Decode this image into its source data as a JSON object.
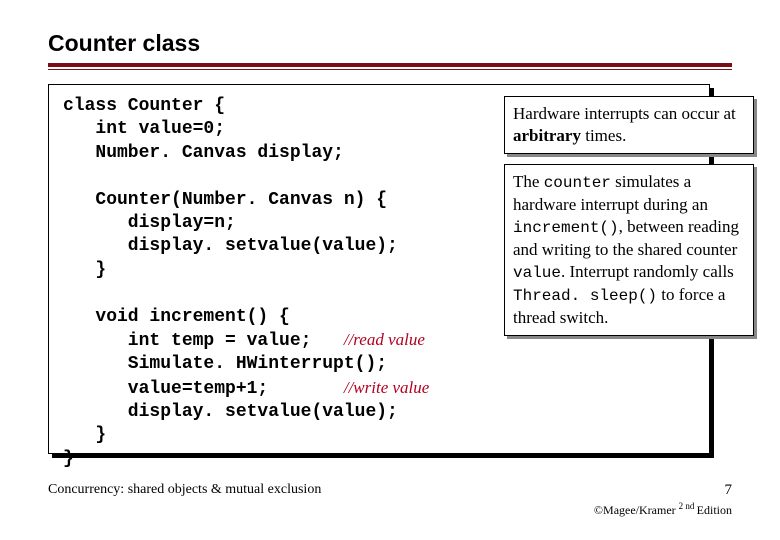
{
  "title": "Counter class",
  "code": {
    "l1": "class Counter {",
    "l2": "   int value=0;",
    "l3": "   Number. Canvas display;",
    "l4": "",
    "l5": "   Counter(Number. Canvas n) {",
    "l6": "      display=n;",
    "l7": "      display. setvalue(value);",
    "l8": "   }",
    "l9": "",
    "l10": "   void increment() {",
    "l11a": "      int temp = value;   ",
    "l11c": "//read value",
    "l12": "      Simulate. HWinterrupt();",
    "l13a": "      value=temp+1;       ",
    "l13c": "//write value",
    "l14": "      display. setvalue(value);",
    "l15": "   }",
    "l16": "}"
  },
  "callout1": {
    "t1": "Hardware interrupts can occur at ",
    "bold1": "arbitrary",
    "t2": " times."
  },
  "callout2": {
    "t1": "The ",
    "m1": "counter",
    "t2": " simulates a hardware interrupt during an ",
    "m2": "increment()",
    "t3": ", between reading and writing to the shared counter ",
    "m3": "value",
    "t4": ". Interrupt randomly calls ",
    "m4": "Thread. sleep()",
    "t5": " to force a thread switch."
  },
  "footer": {
    "left": "Concurrency: shared objects & mutual exclusion",
    "pagenum": "7",
    "credit1": "©Magee/Kramer ",
    "credit_sup": "2 nd ",
    "credit2": "Edition"
  }
}
